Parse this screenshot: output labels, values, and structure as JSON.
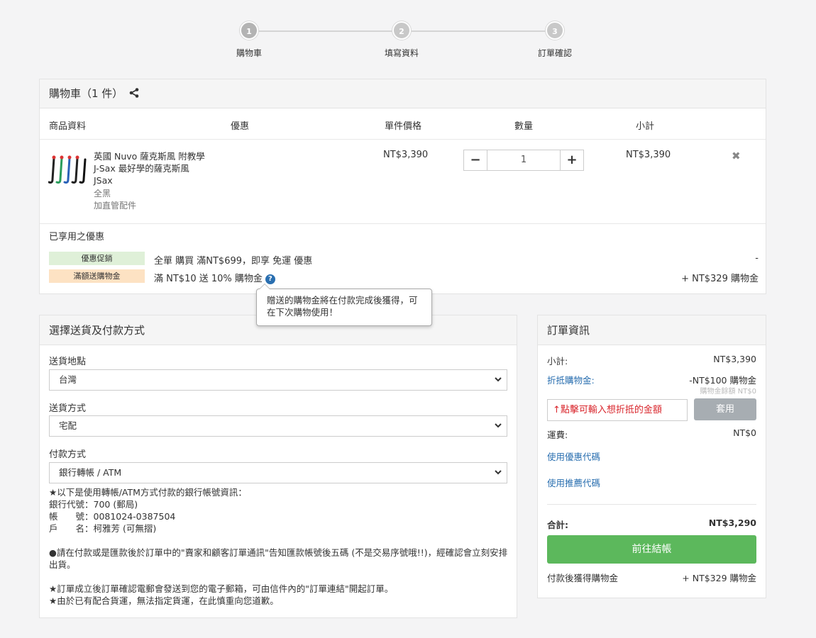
{
  "steps": [
    {
      "num": "1",
      "label": "購物車"
    },
    {
      "num": "2",
      "label": "填寫資料"
    },
    {
      "num": "3",
      "label": "訂單確認"
    }
  ],
  "cart": {
    "title": "購物車（1 件）",
    "columns": {
      "product": "商品資料",
      "discount": "優惠",
      "unit_price": "單件價格",
      "quantity": "數量",
      "subtotal": "小計"
    },
    "item": {
      "name": "英國 Nuvo 薩克斯風 附教學 J-Sax 最好學的薩克斯風 JSax",
      "variant": "全黑",
      "addon": "加直管配件",
      "unit_price": "NT$3,390",
      "quantity": "1",
      "subtotal": "NT$3,390",
      "minus": "−",
      "plus": "+",
      "remove": "✖"
    },
    "promo_title": "已享用之優惠",
    "promos": [
      {
        "badge": "優惠促銷",
        "text": "全單 購買 滿NT$699，即享 免運 優惠",
        "right": "-"
      },
      {
        "badge": "滿額送購物金",
        "text": "滿 NT$10 送 10% 購物金",
        "right": "+ NT$329 購物金"
      }
    ],
    "tooltip": "贈送的購物金將在付款完成後獲得，可在下次購物使用！"
  },
  "shipping": {
    "title": "選擇送貨及付款方式",
    "country_label": "送貨地點",
    "country_value": "台灣",
    "method_label": "送貨方式",
    "method_value": "宅配",
    "payment_label": "付款方式",
    "payment_value": "銀行轉帳 / ATM",
    "info": [
      "★以下是使用轉帳/ATM方式付款的銀行帳號資訊：",
      "銀行代號：700 (郵局)",
      "帳　　號：0081024-0387504",
      "戶　　名：柯雅芳 (可無摺)",
      "●請在付款或是匯款後於訂單中的\"賣家和顧客訂單通訊\"告知匯款帳號後五碼 (不是交易序號哦!!)，經確認會立刻安排出貨。",
      "★訂單成立後訂單確認電郵會發送到您的電子郵箱，可由信件內的\"訂單連結\"開起訂單。",
      "★由於已有配合貨運，無法指定貨運，在此慎重向您道歉。"
    ]
  },
  "order": {
    "title": "訂單資訊",
    "subtotal_label": "小計:",
    "subtotal_value": "NT$3,390",
    "points_label": "折抵購物金:",
    "points_value": "-NT$100 購物金",
    "points_balance": "購物金餘額 NT$0",
    "points_placeholder": "↑點擊可輸入想折抵的金額",
    "apply": "套用",
    "shipping_label": "運費:",
    "shipping_value": "NT$0",
    "coupon_link": "使用優惠代碼",
    "referral_link": "使用推薦代碼",
    "total_label": "合計:",
    "total_value": "NT$3,290",
    "checkout": "前往結帳",
    "earn_label": "付款後獲得購物金",
    "earn_value": "+ NT$329 購物金"
  }
}
